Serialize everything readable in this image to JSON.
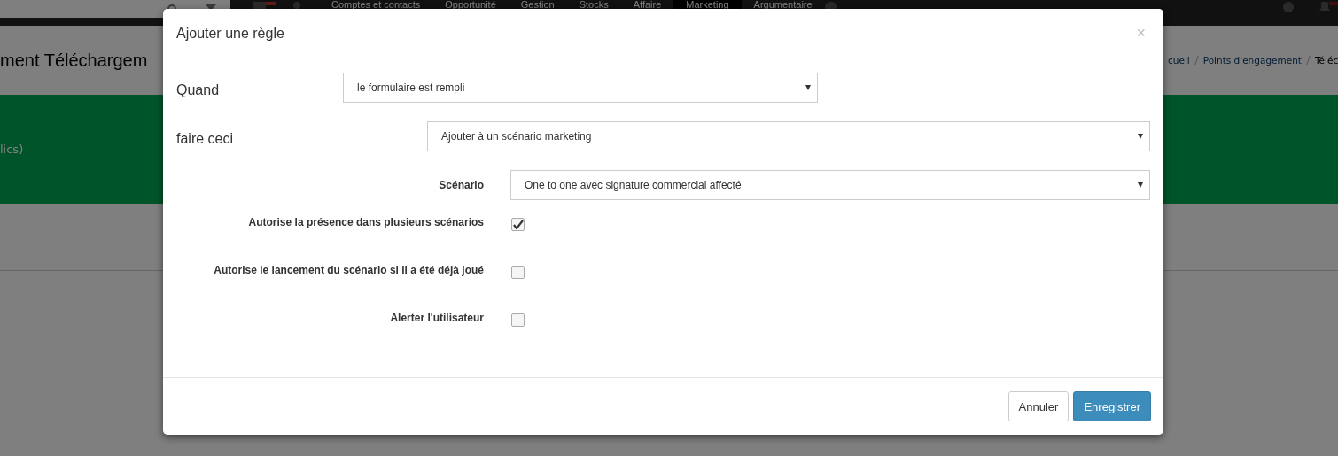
{
  "navbar": {
    "links": [
      {
        "label": "Comptes et contacts",
        "selected": false
      },
      {
        "label": "Opportunité",
        "selected": false
      },
      {
        "label": "Gestion",
        "selected": false
      },
      {
        "label": "Stocks",
        "selected": false
      },
      {
        "label": "Affaire",
        "selected": false
      },
      {
        "label": "Marketing",
        "selected": true
      },
      {
        "label": "Argumentaire",
        "selected": false
      }
    ]
  },
  "page": {
    "title": "ment Téléchargem",
    "breadcrumb": [
      "cueil",
      "Points d'engagement",
      "Téléc"
    ],
    "banner_text": "lics)"
  },
  "modal": {
    "title": "Ajouter une règle",
    "close": "×",
    "fields": [
      {
        "kind": "main-select",
        "label": "Quand",
        "value": "le formulaire est rempli"
      },
      {
        "kind": "main-select",
        "label": "faire ceci",
        "value": "Ajouter à un scénario marketing"
      },
      {
        "kind": "select",
        "label": "Scénario",
        "value": "One to one avec signature commercial affecté"
      },
      {
        "kind": "checkbox",
        "label": "Autorise la présence dans plusieurs scénarios",
        "checked": true
      },
      {
        "kind": "checkbox",
        "label": "Autorise le lancement du scénario si il a été déjà joué",
        "checked": false
      },
      {
        "kind": "checkbox",
        "label": "Alerter l'utilisateur",
        "checked": false
      }
    ],
    "buttons": [
      {
        "label": "Annuler",
        "kind": "default"
      },
      {
        "label": "Enregistrer",
        "kind": "primary"
      }
    ]
  }
}
